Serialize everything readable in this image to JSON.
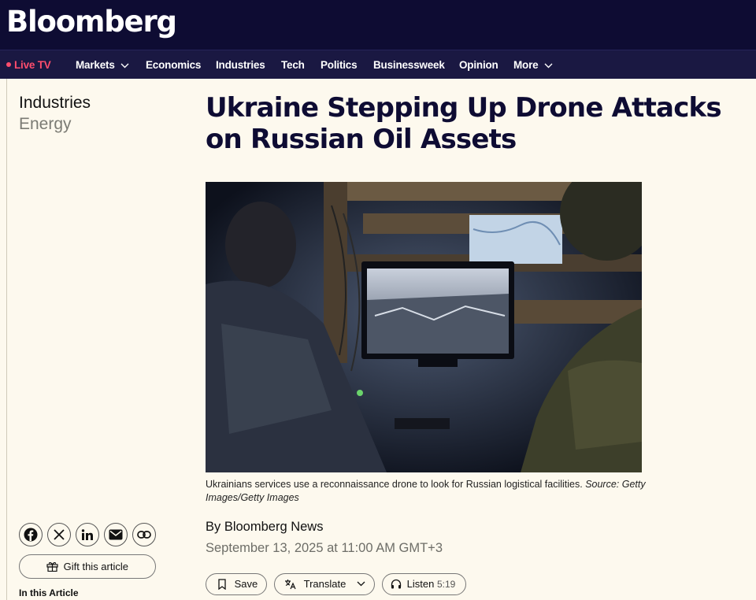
{
  "header": {
    "logo": "Bloomberg"
  },
  "nav": {
    "live": "Live TV",
    "items": [
      {
        "label": "Markets"
      },
      {
        "label": "Economics"
      },
      {
        "label": "Industries"
      },
      {
        "label": "Tech"
      },
      {
        "label": "Politics"
      },
      {
        "label": "Businessweek"
      },
      {
        "label": "Opinion"
      },
      {
        "label": "More"
      }
    ]
  },
  "breadcrumb": {
    "section": "Industries",
    "subsection": "Energy"
  },
  "article": {
    "headline": "Ukraine Stepping Up Drone Attacks on Russian Oil Assets",
    "caption": "Ukrainians services use a reconnaissance drone to look for Russian logistical facilities.",
    "caption_source": "Source: Getty Images/Getty Images",
    "byline": "By Bloomberg News",
    "date": "September 13, 2025 at 11:00 AM GMT+3"
  },
  "actions": {
    "save": "Save",
    "translate": "Translate",
    "listen": "Listen",
    "listen_duration": "5:19"
  },
  "sidebar": {
    "share_icons": [
      "facebook-icon",
      "x-icon",
      "linkedin-icon",
      "email-icon",
      "link-icon"
    ],
    "gift": "Gift this article",
    "in_this_article": "In this Article"
  },
  "colors": {
    "header_bg": "#0e0c33",
    "nav_bg": "#1a1842",
    "live": "#ff4d6d",
    "page_bg": "#fdf9ee"
  }
}
